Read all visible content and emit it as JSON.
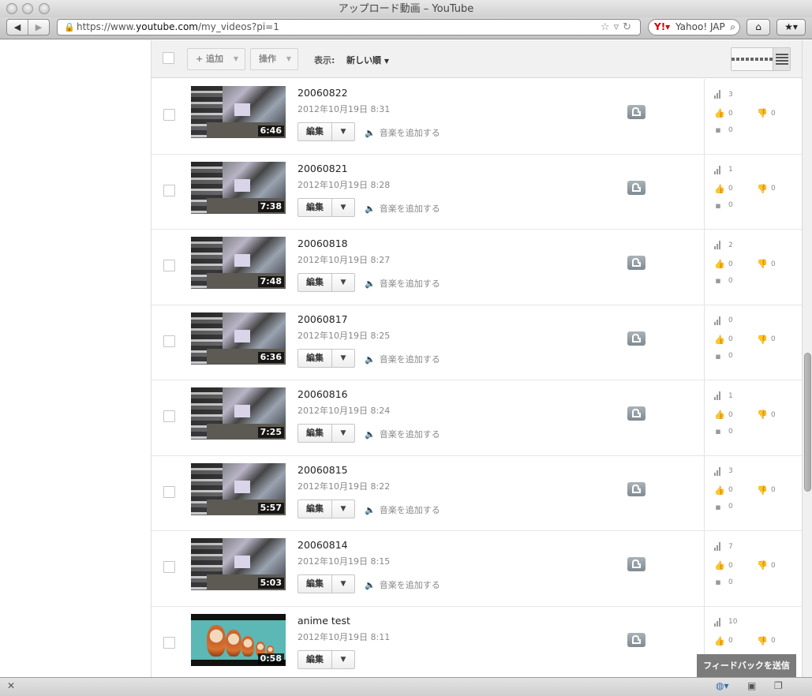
{
  "window": {
    "title": "アップロード動画 – YouTube"
  },
  "browser": {
    "url_prefix": "https://www.",
    "url_host": "youtube.com",
    "url_path": "/my_videos?pi=1",
    "search_text": "Yahoo! JAP"
  },
  "actionbar": {
    "add_label": "+ 追加",
    "actions_label": "操作",
    "display_label": "表示:",
    "sort_value": "新しい順"
  },
  "row_common": {
    "edit_label": "編集",
    "add_music_label": "音楽を追加する"
  },
  "videos": [
    {
      "title": "20060822",
      "date": "2012年10月19日 8:31",
      "duration": "6:46",
      "views": "3",
      "likes": "0",
      "dislikes": "0",
      "comments": "0",
      "show_music": true
    },
    {
      "title": "20060821",
      "date": "2012年10月19日 8:28",
      "duration": "7:38",
      "views": "1",
      "likes": "0",
      "dislikes": "0",
      "comments": "0",
      "show_music": true
    },
    {
      "title": "20060818",
      "date": "2012年10月19日 8:27",
      "duration": "7:48",
      "views": "2",
      "likes": "0",
      "dislikes": "0",
      "comments": "0",
      "show_music": true
    },
    {
      "title": "20060817",
      "date": "2012年10月19日 8:25",
      "duration": "6:36",
      "views": "0",
      "likes": "0",
      "dislikes": "0",
      "comments": "0",
      "show_music": true
    },
    {
      "title": "20060816",
      "date": "2012年10月19日 8:24",
      "duration": "7:25",
      "views": "1",
      "likes": "0",
      "dislikes": "0",
      "comments": "0",
      "show_music": true
    },
    {
      "title": "20060815",
      "date": "2012年10月19日 8:22",
      "duration": "5:57",
      "views": "3",
      "likes": "0",
      "dislikes": "0",
      "comments": "0",
      "show_music": true
    },
    {
      "title": "20060814",
      "date": "2012年10月19日 8:15",
      "duration": "5:03",
      "views": "7",
      "likes": "0",
      "dislikes": "0",
      "comments": "0",
      "show_music": true
    },
    {
      "title": "anime test",
      "date": "2012年10月19日 8:11",
      "duration": "0:58",
      "views": "10",
      "likes": "0",
      "dislikes": "0",
      "comments": "",
      "show_music": false
    }
  ],
  "feedback_label": "フィードバックを送信",
  "icons": {
    "views": "bar-chart-icon",
    "likes": "thumbs-up-icon",
    "dislikes": "thumbs-down-icon",
    "comments": "comment-icon",
    "privacy": "unlocked-icon",
    "music": "speaker-icon"
  }
}
